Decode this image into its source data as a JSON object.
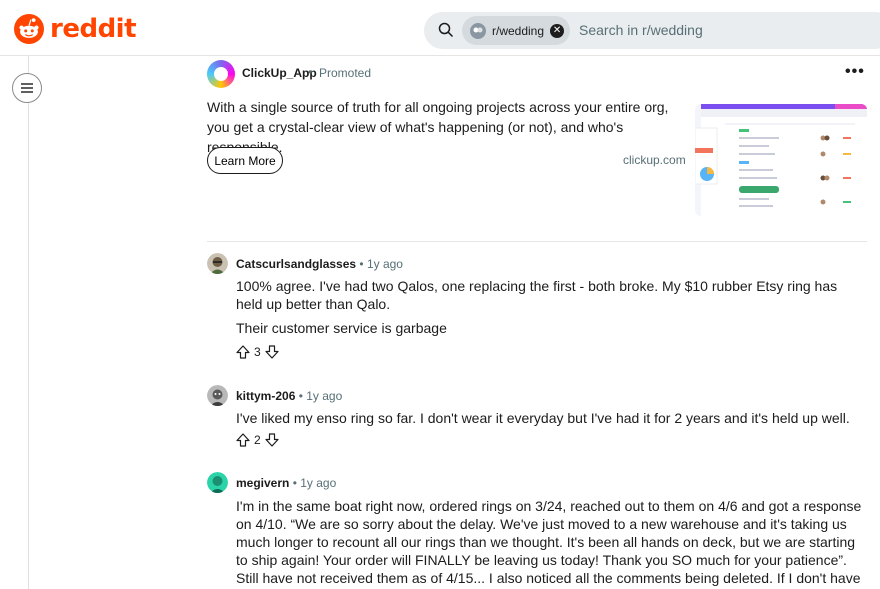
{
  "header": {
    "logo_text": "reddit",
    "search": {
      "chip_label": "r/wedding",
      "placeholder": "Search in r/wedding"
    }
  },
  "ad": {
    "advertiser": "ClickUp_App",
    "separator": "•",
    "promoted_label": "Promoted",
    "body": "With a single source of truth for all ongoing projects across your entire org, you get a crystal-clear view of what's happening (or not), and who's responsible.",
    "cta_label": "Learn More",
    "domain": "clickup.com"
  },
  "comments": [
    {
      "author": "Catscurlsandglasses",
      "time": "• 1y ago",
      "paragraphs": [
        "100% agree. I've had two Qalos, one replacing the first - both broke. My $10 rubber Etsy ring has held up better than Qalo.",
        "Their customer service is garbage"
      ],
      "score": "3"
    },
    {
      "author": "kittym-206",
      "time": "• 1y ago",
      "paragraphs": [
        "I've liked my enso ring so far. I don't wear it everyday but I've had it for 2 years and it's held up well."
      ],
      "score": "2"
    },
    {
      "author": "megivern",
      "time": "• 1y ago",
      "paragraphs": [
        "I'm in the same boat right now, ordered rings on 3/24, reached out to them on 4/6 and got a response on 4/10. “We are so sorry about the delay. We've just moved to a new warehouse and it's taking us much longer to recount all our rings than we thought. It's been all hands on deck, but we are starting to ship again! Your order will FINALLY be leaving us today! Thank you SO much for your patience”. Still have not received them as of 4/15... I also noticed all the comments being deleted. If I don't have them by Friday, I will be disputing my"
      ]
    }
  ],
  "colors": {
    "brand": "#ff4500",
    "meta_text": "#576f76",
    "search_bg": "#eaedef"
  }
}
